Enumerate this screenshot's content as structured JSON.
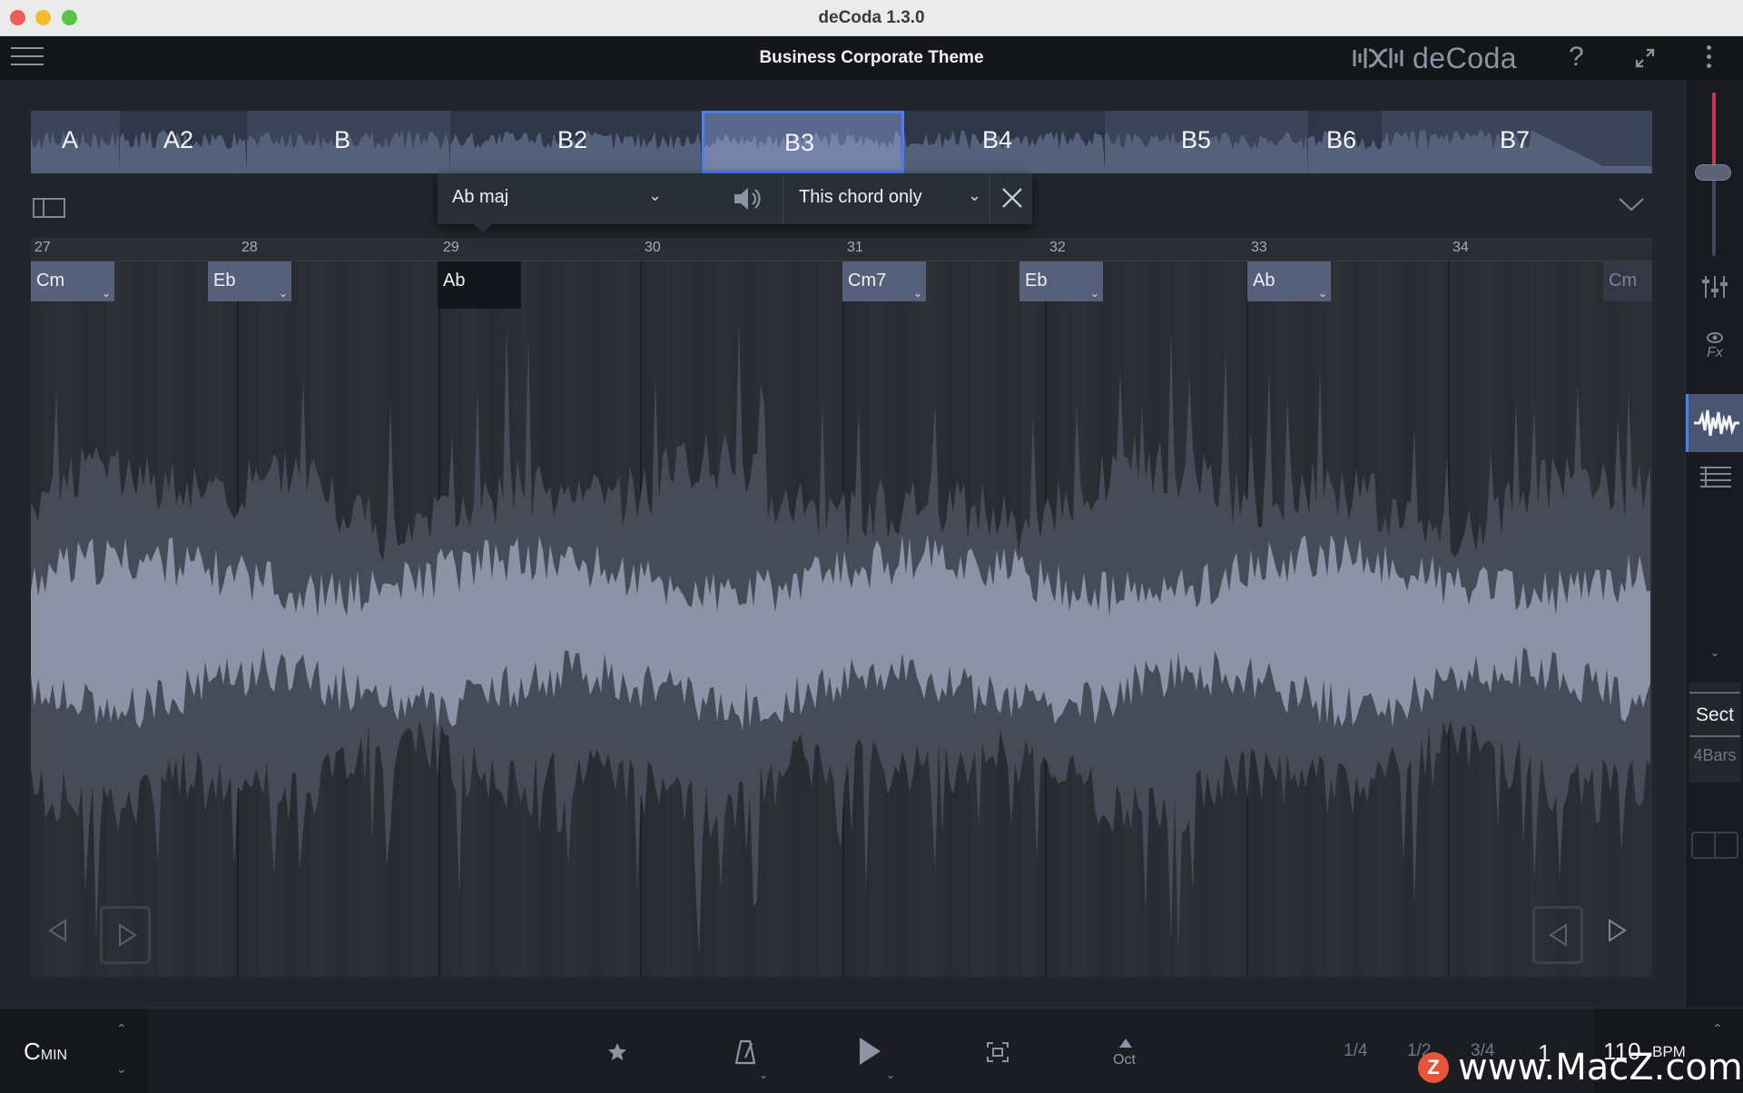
{
  "window": {
    "title": "deCoda 1.3.0"
  },
  "header": {
    "document_title": "Business Corporate Theme",
    "logo_text": "deCoda",
    "help_glyph": "?"
  },
  "sections": [
    {
      "label": "A",
      "selected": false
    },
    {
      "label": "A2",
      "selected": false
    },
    {
      "label": "B",
      "selected": false
    },
    {
      "label": "B2",
      "selected": false
    },
    {
      "label": "B3",
      "selected": true
    },
    {
      "label": "B4",
      "selected": false
    },
    {
      "label": "B5",
      "selected": false
    },
    {
      "label": "B6",
      "selected": false
    },
    {
      "label": "B7",
      "selected": false
    }
  ],
  "chord_popup": {
    "chord_value": "Ab maj",
    "scope_value": "This chord only"
  },
  "timeline": {
    "bar_numbers": [
      "27",
      "28",
      "29",
      "30",
      "31",
      "32",
      "33",
      "34"
    ],
    "chords": [
      {
        "label": "Cm",
        "state": "normal"
      },
      {
        "label": "Eb",
        "state": "normal"
      },
      {
        "label": "Ab",
        "state": "active"
      },
      {
        "label": "Cm7",
        "state": "normal"
      },
      {
        "label": "Eb",
        "state": "normal"
      },
      {
        "label": "Ab",
        "state": "normal"
      },
      {
        "label": "Cm",
        "state": "faint"
      }
    ]
  },
  "sidebar": {
    "sect_label": "Sect",
    "bars_label": "4Bars",
    "fx_label": "Fx"
  },
  "transport": {
    "key_root": "C",
    "key_mode": "MIN",
    "octave_label": "Oct",
    "speeds": [
      "1/4",
      "1/2",
      "3/4"
    ],
    "count": "1",
    "bpm_value": "110",
    "bpm_unit": "BPM"
  },
  "watermark": {
    "badge": "Z",
    "text": "www.MacZ.com"
  },
  "colors": {
    "accent": "#4d7ef0",
    "chord_button": "#56607a",
    "waveform": "#8c93a7",
    "background": "#22252b"
  }
}
